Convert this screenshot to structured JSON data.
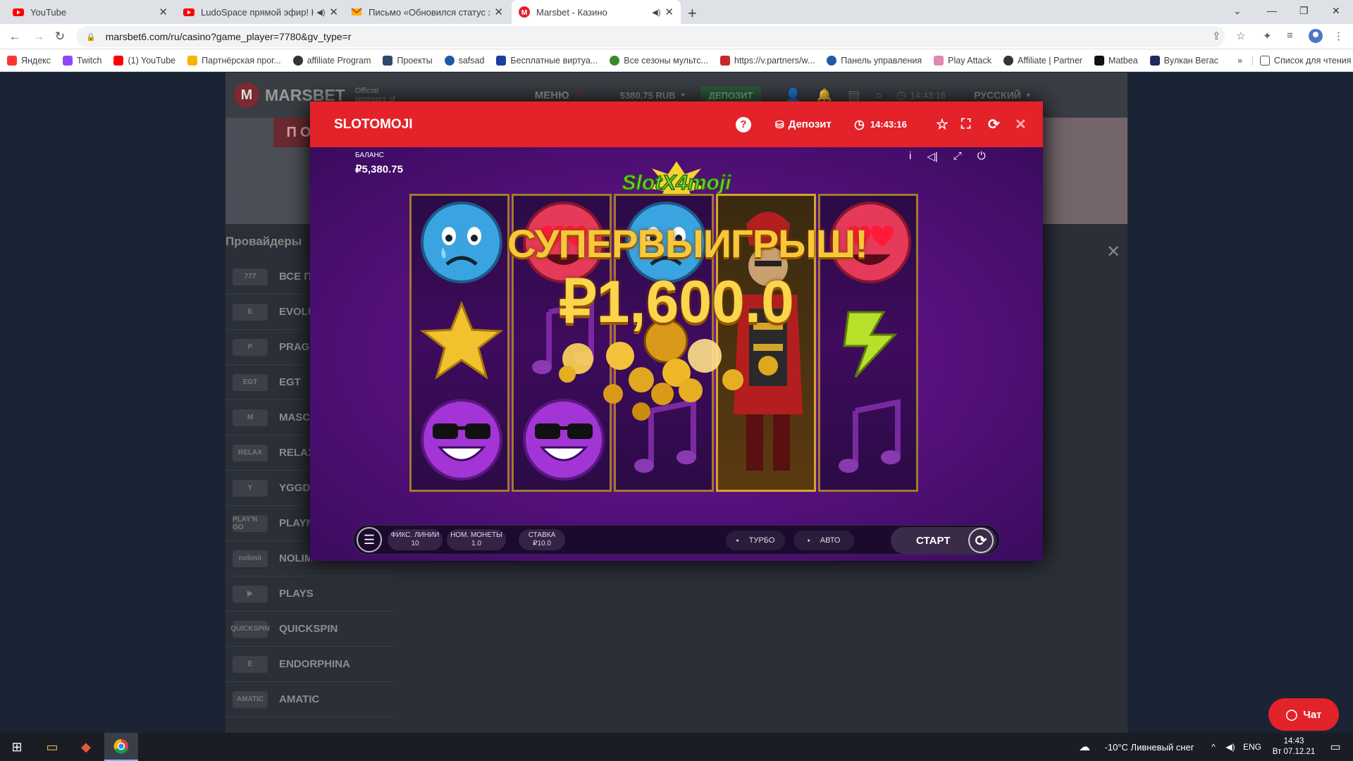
{
  "browser": {
    "tabs": [
      {
        "title": "YouTube",
        "favicon": "youtube-icon"
      },
      {
        "title": "LudoSpace прямой эфир! Ка",
        "favicon": "youtube-icon"
      },
      {
        "title": "Письмо «Обновился статус зака",
        "favicon": "mail-icon"
      },
      {
        "title": "Marsbet - Казино",
        "favicon": "marsbet-icon"
      }
    ],
    "new_tab_label": "+",
    "close_tab_label": "✕",
    "url": "marsbet6.com/ru/casino?game_player=7780&gv_type=r",
    "bookmarks": [
      {
        "label": "Яндекс",
        "color": "#ff3333"
      },
      {
        "label": "Twitch",
        "color": "#9146ff"
      },
      {
        "label": "(1) YouTube",
        "color": "#ff0000"
      },
      {
        "label": "Партнёрская прог...",
        "color": "#f5b400"
      },
      {
        "label": "affiliate Program",
        "color": "#333333"
      },
      {
        "label": "Проекты",
        "color": "#2c4a6a"
      },
      {
        "label": "safsad",
        "color": "#1e5aa8"
      },
      {
        "label": "Бесплатные виртуа...",
        "color": "#1a3fa0"
      },
      {
        "label": "Все сезоны мультс...",
        "color": "#3a8a2a"
      },
      {
        "label": "https://v.partners/w...",
        "color": "#c62828"
      },
      {
        "label": "Панель управления",
        "color": "#1e5aa8"
      },
      {
        "label": "Play Attack",
        "color": "#e08ab0"
      },
      {
        "label": "Affiliate | Partner",
        "color": "#333333"
      },
      {
        "label": "Matbea",
        "color": "#111111"
      },
      {
        "label": "Вулкан Вегас",
        "color": "#1e2a5a"
      }
    ],
    "bookmarks_more": "»",
    "reading_list": "Список для чтения"
  },
  "site": {
    "logo": "MARSBET",
    "sponsor": "Official sponsors of",
    "menu": "МЕНЮ",
    "balance": "5380.75 RUB",
    "deposit": "ДЕПОЗИТ",
    "time": "14:43:16",
    "language": "РУССКИЙ",
    "promo_button": "ПОДРОБНЕЕ",
    "providers_title": "Провайдеры",
    "providers": [
      {
        "name": "ВСЕ ПР",
        "logo": "777"
      },
      {
        "name": "EVOLU",
        "logo": "E"
      },
      {
        "name": "PRAGM",
        "logo": "P"
      },
      {
        "name": "EGT",
        "logo": "EGT"
      },
      {
        "name": "MASCO",
        "logo": "M"
      },
      {
        "name": "RELAX",
        "logo": "RELAX"
      },
      {
        "name": "YGGDR",
        "logo": "Y"
      },
      {
        "name": "PLAYN",
        "logo": "PLAY'N GO"
      },
      {
        "name": "NOLIM",
        "logo": "nolimit"
      },
      {
        "name": "PLAYS",
        "logo": "▶"
      },
      {
        "name": "QUICKSPIN",
        "logo": "QUICKSPIN"
      },
      {
        "name": "ENDORPHINA",
        "logo": "E"
      },
      {
        "name": "AMATIC",
        "logo": "AMATIC"
      }
    ],
    "chat": "Чат"
  },
  "modal": {
    "title": "SLOTOMOJI",
    "help": "?",
    "deposit": "Депозит",
    "time": "14:43:16",
    "close": "✕"
  },
  "game": {
    "balance_label": "БАЛАНС",
    "balance_value": "₽5,380.75",
    "logo": "SlotX4moji",
    "big_win": "СУПЕРВЫИГРЫШ!",
    "win_amount": "₽1,600.0",
    "reels": [
      [
        "sad-face-icon",
        "star-icon",
        "cool-face-icon"
      ],
      [
        "love-face-icon",
        "music-note-icon",
        "cool-face-icon"
      ],
      [
        "sad-face-icon",
        "gold-coin-icon",
        "music-note-icon"
      ],
      [
        "samurai-icon",
        "samurai-icon",
        "samurai-icon"
      ],
      [
        "love-face-icon",
        "lightning-icon",
        "music-note-icon"
      ]
    ],
    "controls": {
      "lines_label": "ФИКС. ЛИНИИ",
      "lines_value": "10",
      "coin_label": "НОМ. МОНЕТЫ",
      "coin_value": "1.0",
      "bet_label": "СТАВКА",
      "bet_value": "₽10.0",
      "turbo": "ТУРБО",
      "auto": "АВТО",
      "start": "СТАРТ"
    }
  },
  "taskbar": {
    "weather": "-10°C Ливневый снег",
    "lang": "ENG",
    "time": "14:43",
    "date": "Вт 07.12.21"
  }
}
